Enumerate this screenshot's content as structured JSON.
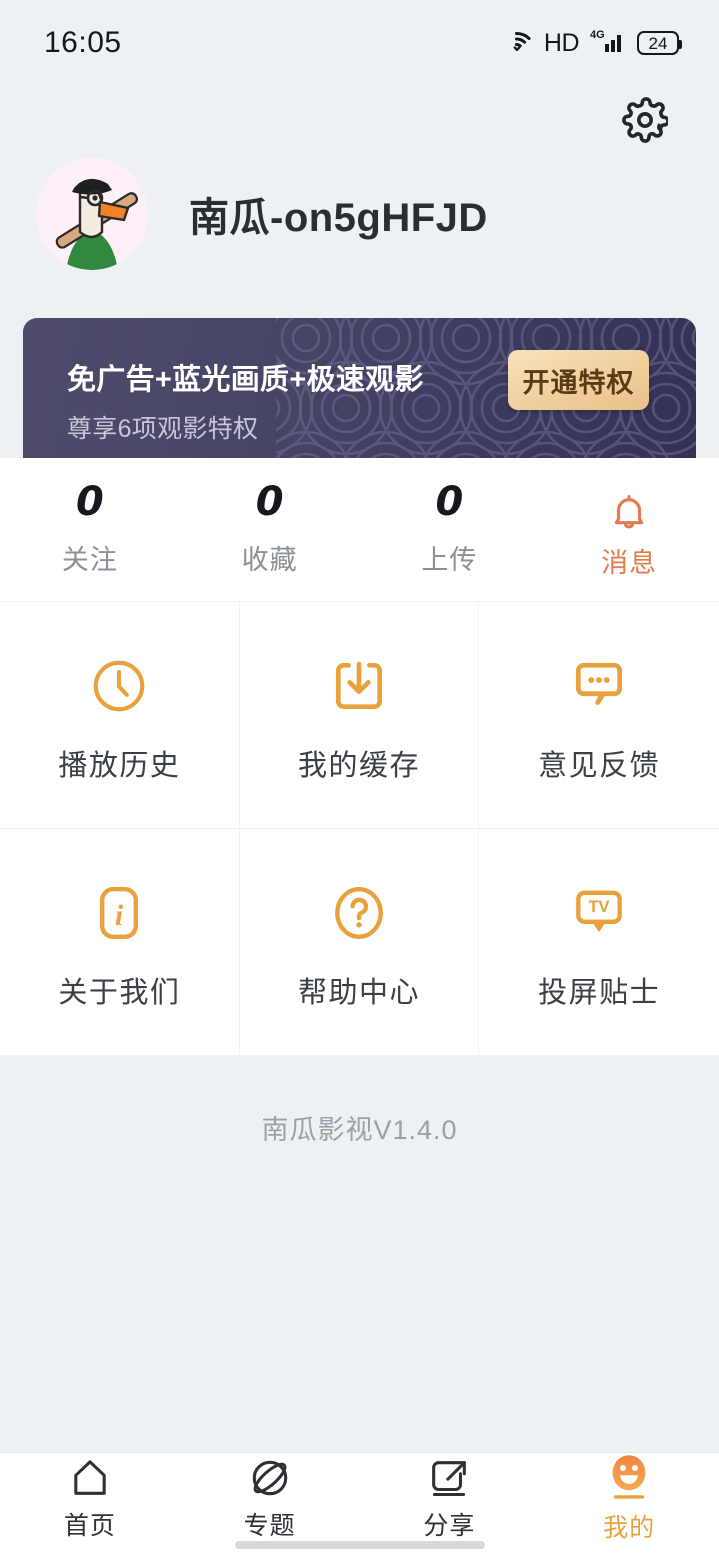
{
  "status_bar": {
    "time": "16:05",
    "hd_label": "HD",
    "network_label": "4G",
    "battery_level": "24",
    "icons": [
      "wifi-icon",
      "hd-icon",
      "signal-icon",
      "battery-icon"
    ]
  },
  "header": {
    "settings_icon": "gear-icon",
    "avatar_alt": "goose-avatar",
    "username": "南瓜-on5gHFJD"
  },
  "vip_banner": {
    "title": "免广告+蓝光画质+极速观影",
    "subtitle": "尊享6项观影特权",
    "button_label": "开通特权",
    "bg_color": "#454366",
    "button_color": "#f0cf9d"
  },
  "stats": [
    {
      "value": "0",
      "label": "关注",
      "icon": null,
      "active": false
    },
    {
      "value": "0",
      "label": "收藏",
      "icon": null,
      "active": false
    },
    {
      "value": "0",
      "label": "上传",
      "icon": null,
      "active": false
    },
    {
      "value": "",
      "label": "消息",
      "icon": "bell-icon",
      "active": true
    }
  ],
  "menu_grid": [
    {
      "label": "播放历史",
      "icon": "clock-icon"
    },
    {
      "label": "我的缓存",
      "icon": "download-icon"
    },
    {
      "label": "意见反馈",
      "icon": "comment-dots-icon"
    },
    {
      "label": "关于我们",
      "icon": "info-icon"
    },
    {
      "label": "帮助中心",
      "icon": "question-circle-icon"
    },
    {
      "label": "投屏贴士",
      "icon": "tv-cast-icon"
    }
  ],
  "version_text": "南瓜影视V1.4.0",
  "tab_bar": [
    {
      "label": "首页",
      "icon": "home-icon",
      "active": false
    },
    {
      "label": "专题",
      "icon": "planet-icon",
      "active": false
    },
    {
      "label": "分享",
      "icon": "share-icon",
      "active": false
    },
    {
      "label": "我的",
      "icon": "smiley-face-icon",
      "active": true
    }
  ],
  "colors": {
    "accent_orange": "#e9a23b",
    "message_orange": "#e27b4e",
    "page_bg": "#eef1f3",
    "card_bg": "#ffffff"
  }
}
